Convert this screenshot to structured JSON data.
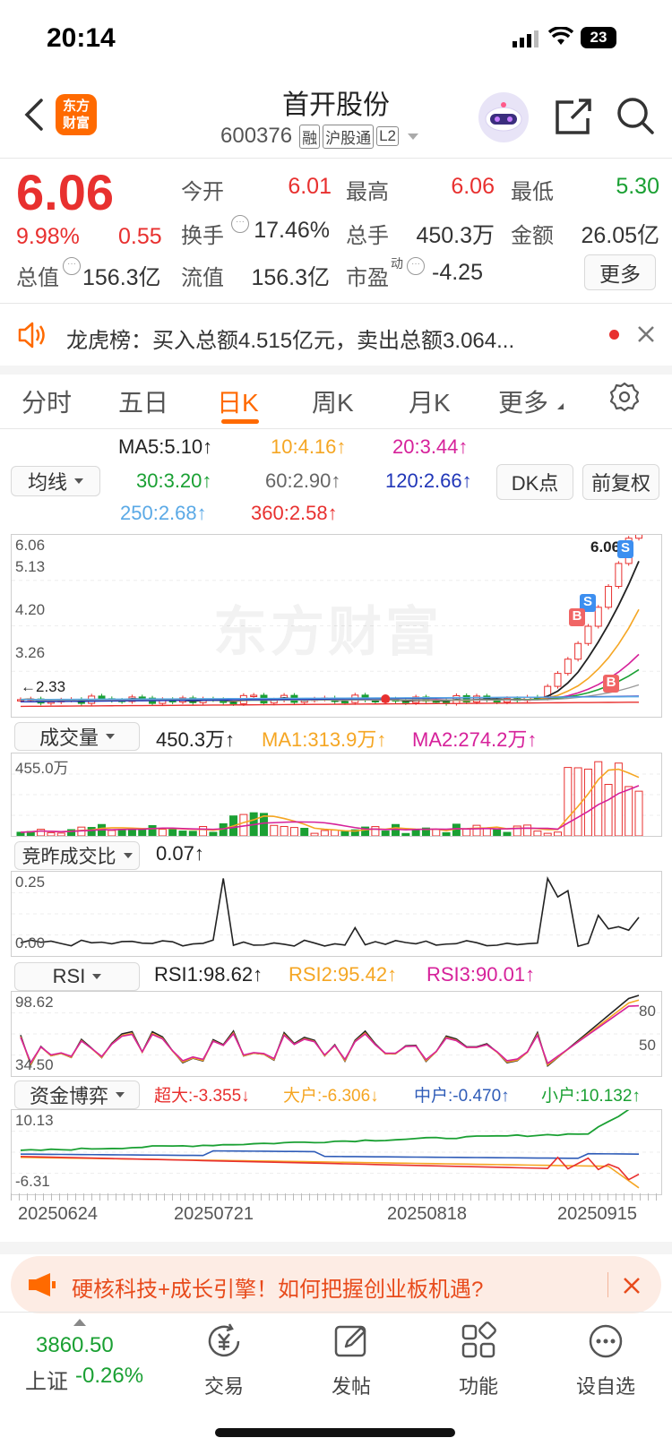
{
  "status_bar": {
    "time": "20:14",
    "battery": "23"
  },
  "header": {
    "title": "首开股份",
    "code": "600376",
    "badges": [
      "融",
      "沪股通",
      "L2"
    ],
    "app_logo": "东方\n财富"
  },
  "quote": {
    "price": "6.06",
    "pct": "9.98%",
    "chg": "0.55",
    "fields": [
      {
        "label": "今开",
        "value": "6.01"
      },
      {
        "label": "最高",
        "value": "6.06"
      },
      {
        "label": "最低",
        "value": "5.30"
      },
      {
        "label": "换手",
        "value": "17.46%"
      },
      {
        "label": "总手",
        "value": "450.3万"
      },
      {
        "label": "金额",
        "value": "26.05亿"
      },
      {
        "label": "总值",
        "value": "156.3亿"
      },
      {
        "label": "流值",
        "value": "156.3亿"
      },
      {
        "label": "市盈",
        "value": "-4.25",
        "sup": "动"
      }
    ],
    "more_label": "更多"
  },
  "notice": {
    "text": "龙虎榜：买入总额4.515亿元，卖出总额3.064..."
  },
  "tabs": [
    "分时",
    "五日",
    "日K",
    "周K",
    "月K",
    "更多"
  ],
  "ma": {
    "selector": "均线",
    "items": [
      {
        "text": "MA5:5.10",
        "color": "#222"
      },
      {
        "text": "10:4.16",
        "color": "#f5a623"
      },
      {
        "text": "20:3.44",
        "color": "#d6219a"
      },
      {
        "text": "30:3.20",
        "color": "#1aa033"
      },
      {
        "text": "60:2.90",
        "color": "#666"
      },
      {
        "text": "120:2.66",
        "color": "#2036b8"
      },
      {
        "text": "250:2.68",
        "color": "#5aa9e6"
      },
      {
        "text": "360:2.58",
        "color": "#e8302f"
      }
    ],
    "dk_label": "DK点",
    "fq_label": "前复权"
  },
  "kline": {
    "y_labels": [
      "6.06",
      "5.13",
      "4.20",
      "3.26"
    ],
    "low_label": "2.33",
    "high_label": "6.06",
    "watermark": "东方财富",
    "markers": [
      "S",
      "S",
      "B",
      "B"
    ]
  },
  "volume": {
    "selector": "成交量",
    "value": "450.3万",
    "ma1": "MA1:313.9万",
    "ma2": "MA2:274.2万",
    "ymax": "455.0万"
  },
  "jzcjb": {
    "selector": "竞昨成交比",
    "value": "0.07",
    "ymax": "0.25",
    "ymin": "0.00"
  },
  "rsi": {
    "selector": "RSI",
    "rsi1": "RSI1:98.62",
    "rsi2": "RSI2:95.42",
    "rsi3": "RSI3:90.01",
    "ymax": "98.62",
    "ymin": "34.50",
    "l80": "80",
    "l50": "50"
  },
  "fund": {
    "selector": "资金博弈",
    "super": "超大:-3.355",
    "big": "大户:-6.306",
    "mid": "中户:-0.470",
    "small": "小户:10.132",
    "ymax": "10.13",
    "ymin": "-6.31"
  },
  "dates": [
    "20250624",
    "20250721",
    "20250818",
    "20250915"
  ],
  "promo": {
    "text": "硬核科技+成长引擎！如何把握创业板机遇?"
  },
  "bottom": {
    "index_value": "3860.50",
    "index_name": "上证",
    "index_pct": "-0.26%",
    "items": [
      {
        "label": "交易",
        "icon": "yen-exchange-icon"
      },
      {
        "label": "发帖",
        "icon": "edit-icon"
      },
      {
        "label": "功能",
        "icon": "grid-icon"
      },
      {
        "label": "设自选",
        "icon": "more-dots-icon"
      }
    ]
  },
  "colors": {
    "up": "#e8302f",
    "down": "#1aa033",
    "accent": "#ff6a00"
  }
}
